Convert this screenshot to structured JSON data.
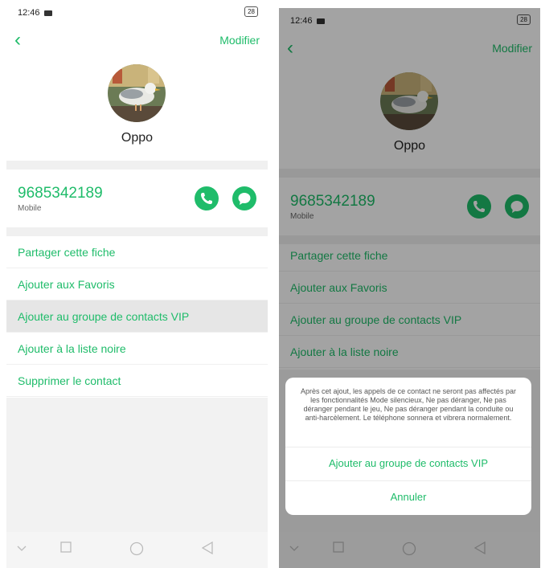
{
  "status": {
    "time": "12:46",
    "battery": "28"
  },
  "header": {
    "back_icon": "‹",
    "modify_label": "Modifier"
  },
  "contact": {
    "name": "Oppo",
    "avatar_icon": "seagull-photo",
    "phone": "9685342189",
    "phone_type": "Mobile"
  },
  "actions": {
    "call_icon": "phone-icon",
    "message_icon": "message-icon"
  },
  "menu": {
    "items": [
      {
        "label": "Partager cette fiche"
      },
      {
        "label": "Ajouter aux Favoris"
      },
      {
        "label": "Ajouter au groupe de contacts VIP"
      },
      {
        "label": "Ajouter à la liste noire"
      },
      {
        "label": "Supprimer le contact"
      }
    ]
  },
  "dialog": {
    "message": "Après cet ajout, les appels de ce contact ne seront pas affectés par les fonctionnalités Mode silencieux, Ne pas déranger, Ne pas déranger pendant le jeu, Ne pas déranger pendant la conduite ou anti-harcèlement. Le téléphone sonnera et vibrera normalement.",
    "confirm_label": "Ajouter au groupe de contacts VIP",
    "cancel_label": "Annuler"
  },
  "colors": {
    "accent": "#1fbc6a",
    "pressed": "#e6e6e6",
    "divider": "#f0f0f0"
  }
}
